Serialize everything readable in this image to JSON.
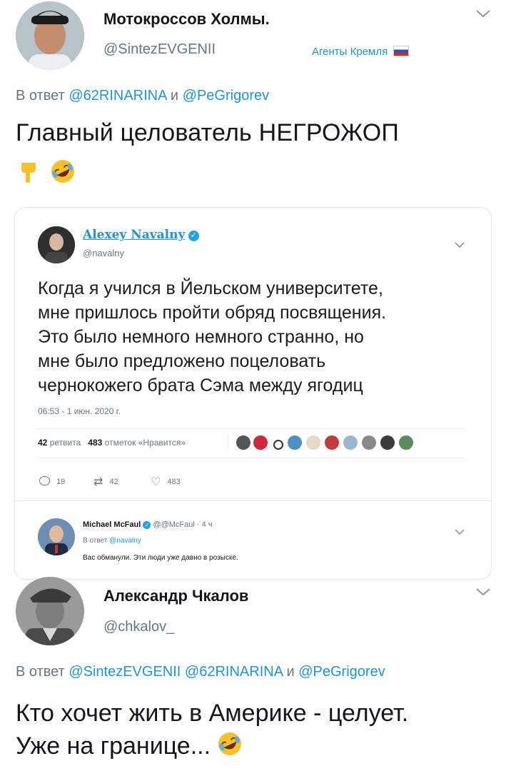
{
  "tweet1": {
    "display_name": "Мотокроссов Холмы.",
    "handle": "@SintezEVGENII",
    "badge": "Агенты Кремля",
    "reply_to_prefix": "В ответ",
    "reply_to_1": "@62RINARINA",
    "reply_to_and": "и",
    "reply_to_2": "@PeGrigorev",
    "text": "Главный целователь НЕГРОЖОП",
    "emojis": [
      "point-down-icon",
      "rofl-icon"
    ]
  },
  "embedded": {
    "display_name": "Alexey Navalny",
    "handle": "@navalny",
    "text_lines": [
      "Когда я учился в Йельском университете,",
      "мне пришлось пройти обряд посвящения.",
      "Это было немного немного странно, но",
      "мне было предложено поцеловать",
      "чернокожего брата Сэма между ягодиц"
    ],
    "timestamp": "06:53 - 1 июн. 2020 г.",
    "retweets_count": "42",
    "retweets_label": "ретвита",
    "likes_count": "483",
    "likes_label": "отметок «Нравится»",
    "actions": {
      "reply": "19",
      "retweet": "42",
      "like": "483"
    },
    "reply": {
      "display_name": "Michael McFaul",
      "handle": "@@McFaul",
      "time": "· 4 ч",
      "reply_to_prefix": "В ответ",
      "reply_to": "@navalny",
      "text": "Вас обманули. Эти люди уже давно в розыске."
    }
  },
  "tweet2": {
    "display_name": "Александр Чкалов",
    "handle": "@chkalov_",
    "reply_to_prefix": "В ответ",
    "reply_to_1": "@SintezEVGENII",
    "reply_to_2": "@62RINARINA",
    "reply_to_and": "и",
    "reply_to_3": "@PeGrigorev",
    "text_line1": "Кто хочет жить в Америке - целует.",
    "text_line2": "Уже на границе...",
    "emoji": "rofl-icon"
  },
  "colors": {
    "link": "#1b95e0",
    "muted": "#657786",
    "verified": "#1da1f2",
    "badge": "#1b95e0"
  }
}
